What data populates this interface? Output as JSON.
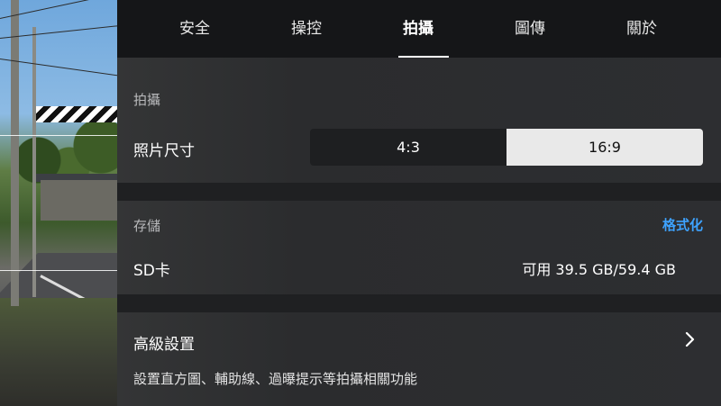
{
  "tabs": [
    {
      "label": "安全"
    },
    {
      "label": "操控"
    },
    {
      "label": "拍攝"
    },
    {
      "label": "圖傳"
    },
    {
      "label": "關於"
    }
  ],
  "active_tab": "拍攝",
  "shooting": {
    "section_title": "拍攝",
    "photo_size_label": "照片尺寸",
    "options": [
      "4:3",
      "16:9"
    ],
    "selected": "16:9"
  },
  "storage": {
    "section_title": "存儲",
    "format_label": "格式化",
    "sd_label": "SD卡",
    "sd_value": "可用 39.5 GB/59.4 GB"
  },
  "advanced": {
    "label": "高級設置",
    "description": "設置直方圖、輔助線、過曝提示等拍攝相關功能"
  },
  "colors": {
    "accent": "#3ea3ff",
    "panel": "#2d2e31",
    "tabbar": "#151618"
  },
  "icons": {
    "advanced_chevron": "chevron-right-icon"
  }
}
